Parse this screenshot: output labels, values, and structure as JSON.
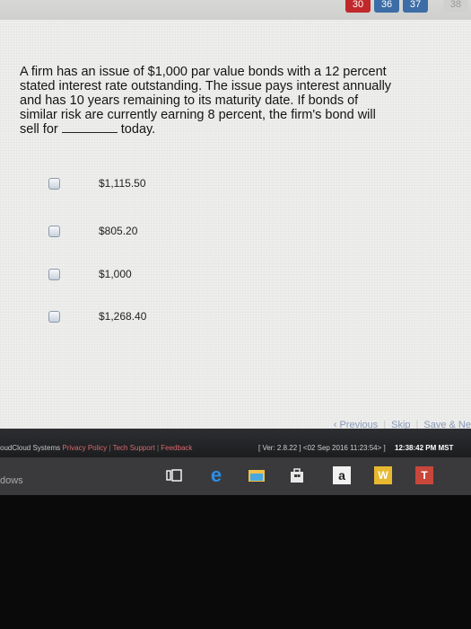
{
  "tabs": [
    {
      "label": "30",
      "style": "red"
    },
    {
      "label": "36",
      "style": "blue"
    },
    {
      "label": "37",
      "style": "blue"
    },
    {
      "label": "38",
      "style": "grey"
    }
  ],
  "question": {
    "line1": "A firm has an issue of $1,000 par value bonds with a 12 percent",
    "line2": "stated interest rate outstanding. The issue pays interest annually",
    "line3": "and has 10 years remaining to its maturity date. If bonds of",
    "line4": "similar risk are currently earning 8 percent, the firm's bond will",
    "line5_pre": "sell for",
    "line5_post": "today."
  },
  "options": [
    {
      "label": "$1,115.50"
    },
    {
      "label": "$805.20"
    },
    {
      "label": "$1,000"
    },
    {
      "label": "$1,268.40"
    }
  ],
  "nav": {
    "previous": "‹ Previous",
    "skip": "Skip",
    "save_next": "Save & Ne"
  },
  "footer": {
    "brand": "oudCloud Systems",
    "privacy": "Privacy Policy",
    "tech_support": "Tech Support",
    "feedback": "Feedback",
    "version": "[ Ver: 2.8.22 ] <02 Sep 2016 11:23:54> ]",
    "time": "12:38:42 PM MST"
  },
  "taskbar": {
    "text": "dows",
    "icons": [
      "task-view-icon",
      "edge-icon",
      "file-explorer-icon",
      "store-icon",
      "amazon-icon",
      "word-icon",
      "powerpoint-icon"
    ]
  },
  "colors": {
    "accent_red": "#c0282b",
    "tab_blue": "#3c6da6",
    "nav_link": "#8a9ab8"
  }
}
